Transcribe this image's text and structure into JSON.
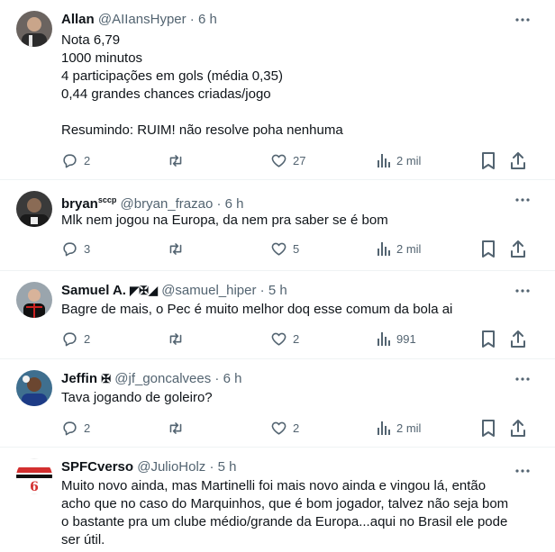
{
  "tweets": [
    {
      "name": "Allan",
      "handle": "@AIIansHyper",
      "sep": "·",
      "time": "6 h",
      "lines": [
        "Nota 6,79",
        "1000 minutos",
        "4 participações em gols (média 0,35)",
        "0,44 grandes chances criadas/jogo",
        "",
        "Resumindo: RUIM! não resolve poha nenhuma"
      ],
      "replies": "2",
      "retweets": "",
      "likes": "27",
      "views": "2 mil"
    },
    {
      "name": "bryan",
      "name_sup": "sccp",
      "handle": "@bryan_frazao",
      "sep": "·",
      "time": "6 h",
      "lines": [
        "Mlk nem jogou na Europa, da nem pra saber se é bom"
      ],
      "replies": "3",
      "retweets": "",
      "likes": "5",
      "views": "2 mil"
    },
    {
      "name": "Samuel A.",
      "name_emoji": "◤✠◢",
      "handle": "@samuel_hiper",
      "sep": "·",
      "time": "5 h",
      "lines": [
        "Bagre de mais, o Pec é muito melhor doq esse comum da bola ai"
      ],
      "replies": "2",
      "retweets": "",
      "likes": "2",
      "views": "991"
    },
    {
      "name": "Jeffin",
      "name_emoji": "✠",
      "handle": "@jf_goncalvees",
      "sep": "·",
      "time": "6 h",
      "lines": [
        "Tava jogando de goleiro?"
      ],
      "replies": "2",
      "retweets": "",
      "likes": "2",
      "views": "2 mil"
    },
    {
      "name": "SPFCverso",
      "handle": "@JulioHolz",
      "sep": "·",
      "time": "5 h",
      "lines": [
        "Muito novo ainda, mas Martinelli foi mais novo ainda e vingou lá, então",
        "acho que no caso do Marquinhos, que é bom jogador, talvez não seja bom",
        "o bastante pra um clube médio/grande da Europa...aqui no Brasil ele pode",
        "ser útil."
      ]
    }
  ],
  "colors": {
    "text": "#0f1419",
    "secondary": "#536471",
    "divider": "#eff3f4"
  },
  "icons": [
    "reply-icon",
    "retweet-icon",
    "like-icon",
    "views-icon",
    "bookmark-icon",
    "share-icon",
    "more-icon"
  ]
}
